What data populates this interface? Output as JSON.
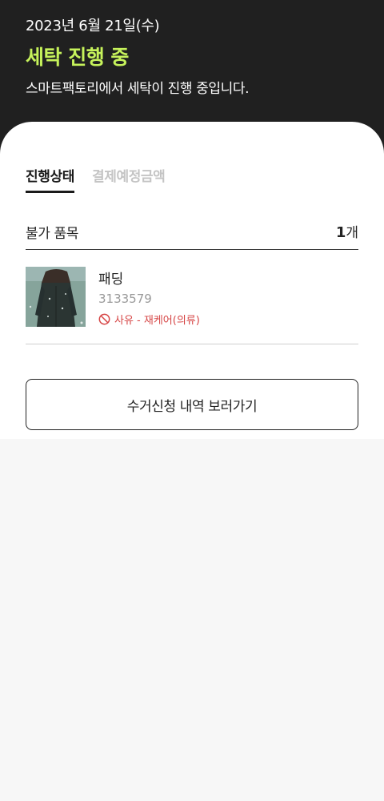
{
  "header": {
    "date": "2023년 6월 21일(수)",
    "status_title": "세탁 진행 중",
    "status_desc": "스마트팩토리에서 세탁이 진행 중입니다."
  },
  "tabs": [
    {
      "label": "진행상태",
      "active": true
    },
    {
      "label": "결제예정금액",
      "active": false
    }
  ],
  "section": {
    "label": "불가 품목",
    "count_number": "1",
    "count_unit": "개"
  },
  "items": [
    {
      "name": "패딩",
      "code": "3133579",
      "reason": "사유 - 재케어(의류)",
      "icon": "prohibited-icon"
    }
  ],
  "button": {
    "label": "수거신청 내역 보러가기"
  },
  "colors": {
    "header_bg": "#202020",
    "accent": "#c6f25b",
    "reason": "#d64545"
  }
}
